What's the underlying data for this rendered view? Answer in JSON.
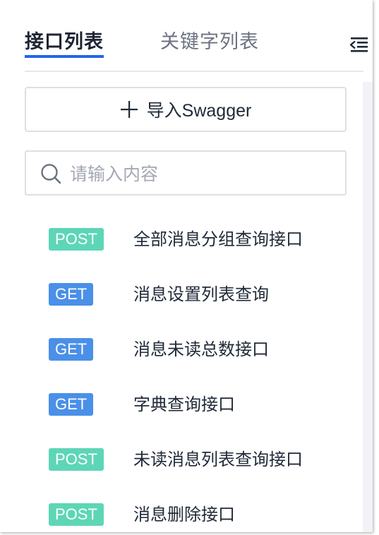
{
  "tabs": {
    "active_label": "接口列表",
    "inactive_label": "关键字列表"
  },
  "icons": {
    "collapse": "menu-fold-icon",
    "plus": "plus-icon",
    "search": "search-icon"
  },
  "import_button": {
    "label": "导入Swagger"
  },
  "search": {
    "placeholder": "请输入内容",
    "value": ""
  },
  "colors": {
    "accent": "#2563eb",
    "post": "#5dd6b6",
    "get": "#4a90e8"
  },
  "apis": [
    {
      "method": "POST",
      "name": "全部消息分组查询接口"
    },
    {
      "method": "GET",
      "name": "消息设置列表查询"
    },
    {
      "method": "GET",
      "name": "消息未读总数接口"
    },
    {
      "method": "GET",
      "name": "字典查询接口"
    },
    {
      "method": "POST",
      "name": "未读消息列表查询接口"
    },
    {
      "method": "POST",
      "name": "消息删除接口"
    }
  ]
}
